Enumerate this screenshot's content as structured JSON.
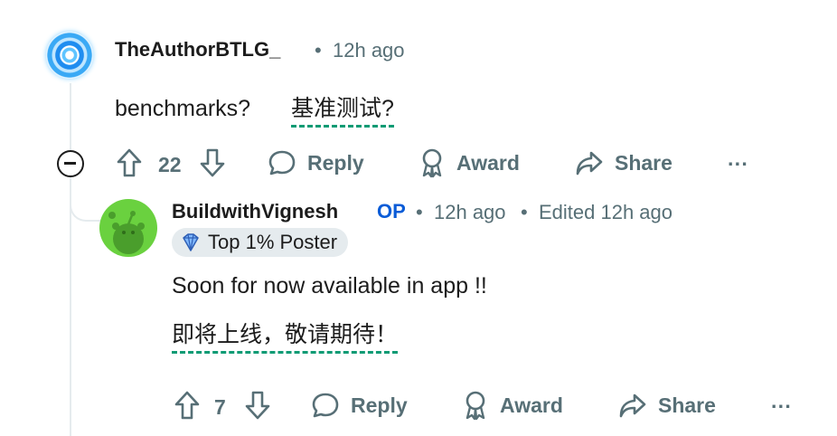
{
  "comment": {
    "username": "TheAuthorBTLG_",
    "time": "12h ago",
    "body_original": "benchmarks?",
    "body_translated": "基准测试?",
    "votes": "22",
    "reply_label": "Reply",
    "award_label": "Award",
    "share_label": "Share",
    "more_label": "···"
  },
  "reply": {
    "username": "BuildwithVignesh",
    "op_label": "OP",
    "time": "12h ago",
    "edited": "Edited 12h ago",
    "flair": "Top 1% Poster",
    "body_original": "Soon for now available in app !!",
    "body_translated": "即将上线，敬请期待！",
    "votes": "7",
    "reply_label": "Reply",
    "award_label": "Award",
    "share_label": "Share",
    "more_label": "···"
  },
  "separator": "•",
  "colors": {
    "text": "#1c1c1c",
    "muted": "#576f76",
    "op": "#0a5cd7",
    "translation_underline": "#0e9b74",
    "thread_line": "#e5ebee",
    "avatar_green": "#6ad13f"
  }
}
